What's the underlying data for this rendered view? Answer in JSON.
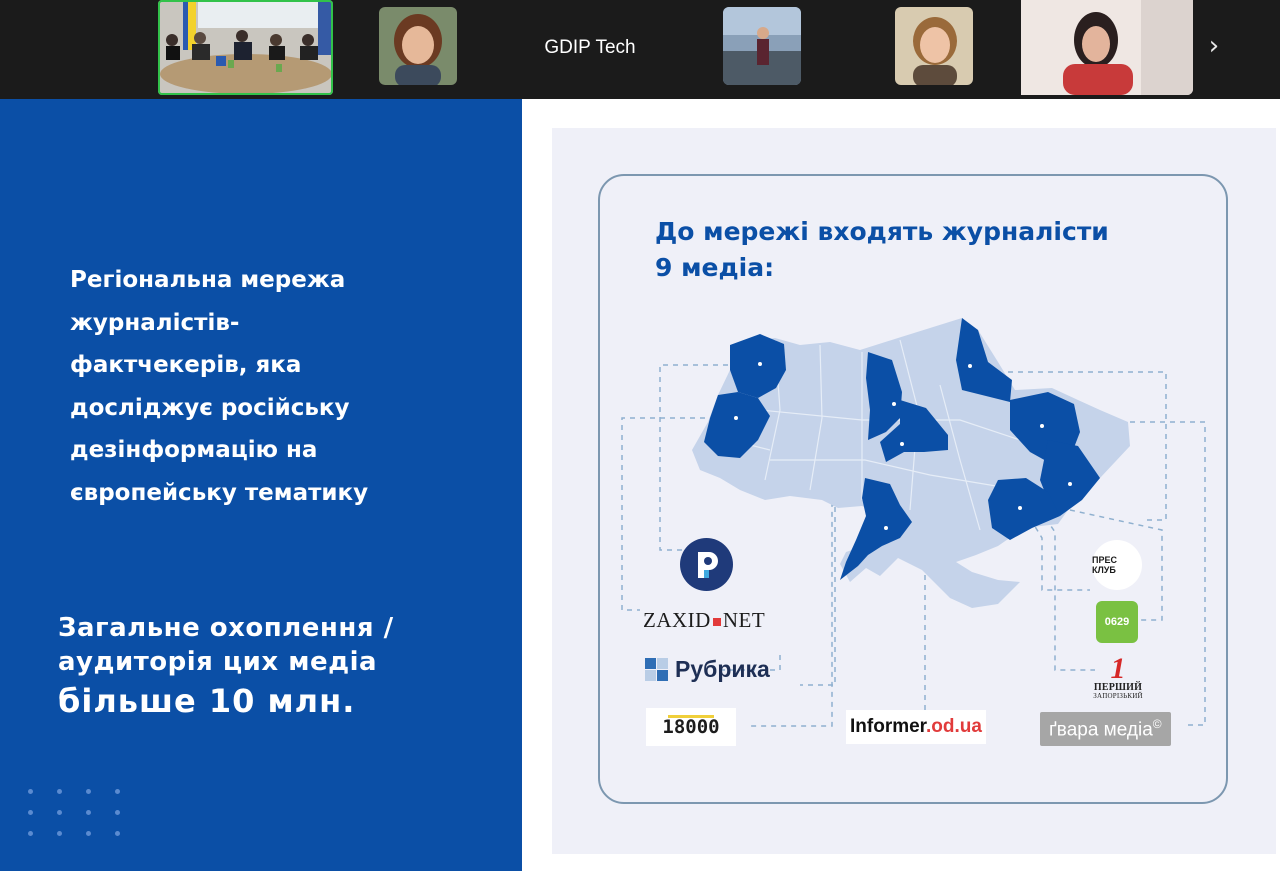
{
  "meeting": {
    "name_tile_label": "GDIP Tech",
    "next_arrow": "›"
  },
  "left_panel": {
    "description": "Регіональна мережа\nжурналістів-\nфактчекерів, яка\nдосліджує російську\nдезінформацію на\nєвропейську тематику",
    "reach_line1": "Загальне охоплення /",
    "reach_line2": "аудиторія цих медіа",
    "reach_line3": "більше 10 млн."
  },
  "slide": {
    "title_line1": "До мережі входять журналісти",
    "title_line2": "9 медіа:",
    "colors": {
      "highlight_region": "#0b4fa6",
      "base_region": "#c5d3ea",
      "connector": "#8fb0cf"
    },
    "logos": {
      "zaxid_left": "ZAXID",
      "zaxid_right": "NET",
      "rubrika": "Рубрика",
      "t18000": "18000",
      "informer_main": "Informer",
      "informer_suffix": ".od.ua",
      "gvara": "ґвара медіа",
      "gvara_mark": "©",
      "presklub": "ПРЕС КЛУБ",
      "n0629": "0629",
      "pershyi_num": "1",
      "pershyi_line1": "ПЕРШИЙ",
      "pershyi_line2": "ЗАПОРІЗЬКИЙ"
    }
  }
}
